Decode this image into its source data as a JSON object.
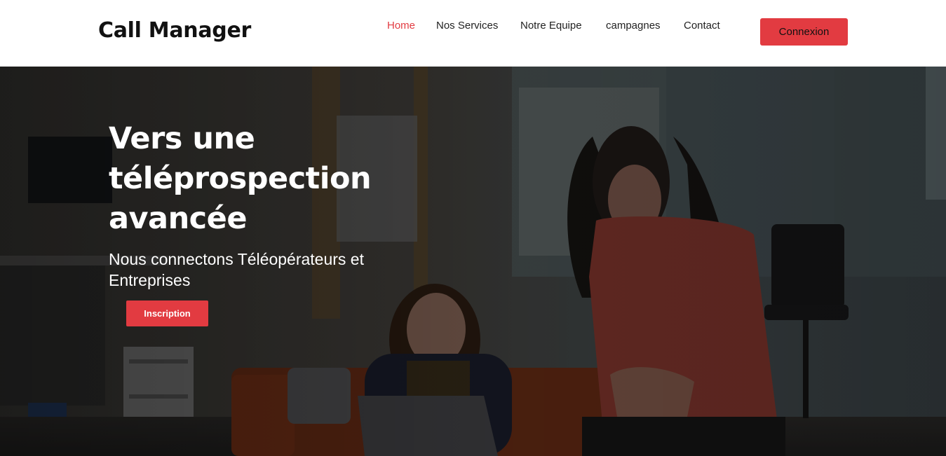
{
  "header": {
    "logo": "Call Manager",
    "nav": [
      {
        "label": "Home",
        "active": true
      },
      {
        "label": "Nos Services",
        "active": false
      },
      {
        "label": "Notre Equipe",
        "active": false
      },
      {
        "label": "campagnes",
        "active": false
      },
      {
        "label": "Contact",
        "active": false
      }
    ],
    "login_button": "Connexion"
  },
  "hero": {
    "title_lines": [
      "Vers une",
      "téléprospection",
      "avancée"
    ],
    "subtitle_lines": [
      "Nous connectons Téléopérateurs et",
      "Entreprises"
    ],
    "cta_button": "Inscription",
    "background_description_icon": "office-photo"
  },
  "colors": {
    "accent": "#e23b41",
    "header_bg": "#ffffff",
    "nav_text": "#222222",
    "hero_text": "#ffffff"
  }
}
